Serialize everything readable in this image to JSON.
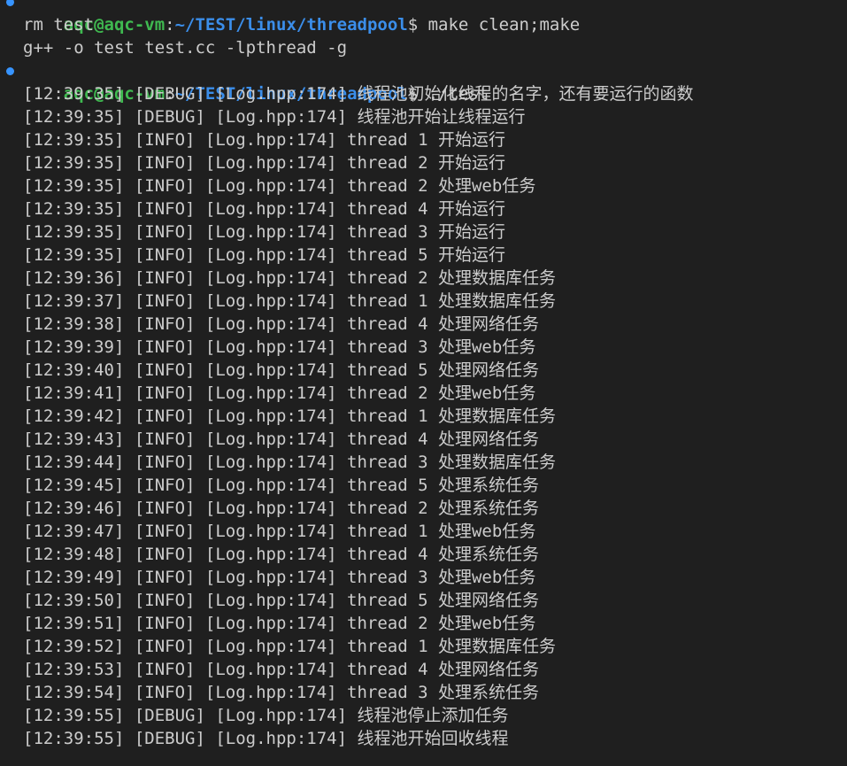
{
  "prompts": [
    {
      "user": "aqc@aqc-vm",
      "colon": ":",
      "path": "~/TEST/linux/threadpool",
      "dollar": "$ ",
      "command": "make clean;make"
    },
    {
      "user": "aqc@aqc-vm",
      "colon": ":",
      "path": "~/TEST/linux/threadpool",
      "dollar": "$ ",
      "command": "./test"
    }
  ],
  "build_output": [
    "rm test",
    "g++ -o test test.cc -lpthread -g"
  ],
  "log_lines": [
    "[12:39:35] [DEBUG] [Log.hpp:174] 线程池初始化线程的名字，还有要运行的函数",
    "[12:39:35] [DEBUG] [Log.hpp:174] 线程池开始让线程运行",
    "[12:39:35] [INFO] [Log.hpp:174] thread 1 开始运行",
    "[12:39:35] [INFO] [Log.hpp:174] thread 2 开始运行",
    "[12:39:35] [INFO] [Log.hpp:174] thread 2 处理web任务",
    "[12:39:35] [INFO] [Log.hpp:174] thread 4 开始运行",
    "[12:39:35] [INFO] [Log.hpp:174] thread 3 开始运行",
    "[12:39:35] [INFO] [Log.hpp:174] thread 5 开始运行",
    "[12:39:36] [INFO] [Log.hpp:174] thread 2 处理数据库任务",
    "[12:39:37] [INFO] [Log.hpp:174] thread 1 处理数据库任务",
    "[12:39:38] [INFO] [Log.hpp:174] thread 4 处理网络任务",
    "[12:39:39] [INFO] [Log.hpp:174] thread 3 处理web任务",
    "[12:39:40] [INFO] [Log.hpp:174] thread 5 处理网络任务",
    "[12:39:41] [INFO] [Log.hpp:174] thread 2 处理web任务",
    "[12:39:42] [INFO] [Log.hpp:174] thread 1 处理数据库任务",
    "[12:39:43] [INFO] [Log.hpp:174] thread 4 处理网络任务",
    "[12:39:44] [INFO] [Log.hpp:174] thread 3 处理数据库任务",
    "[12:39:45] [INFO] [Log.hpp:174] thread 5 处理系统任务",
    "[12:39:46] [INFO] [Log.hpp:174] thread 2 处理系统任务",
    "[12:39:47] [INFO] [Log.hpp:174] thread 1 处理web任务",
    "[12:39:48] [INFO] [Log.hpp:174] thread 4 处理系统任务",
    "[12:39:49] [INFO] [Log.hpp:174] thread 3 处理web任务",
    "[12:39:50] [INFO] [Log.hpp:174] thread 5 处理网络任务",
    "[12:39:51] [INFO] [Log.hpp:174] thread 2 处理web任务",
    "[12:39:52] [INFO] [Log.hpp:174] thread 1 处理数据库任务",
    "[12:39:53] [INFO] [Log.hpp:174] thread 4 处理网络任务",
    "[12:39:54] [INFO] [Log.hpp:174] thread 3 处理系统任务",
    "[12:39:55] [DEBUG] [Log.hpp:174] 线程池停止添加任务",
    "[12:39:55] [DEBUG] [Log.hpp:174] 线程池开始回收线程"
  ],
  "colors": {
    "background": "#1f1f1f",
    "text": "#cccccc",
    "user": "#3fb950",
    "path": "#3b8eea",
    "marker": "#3794ff"
  },
  "icons": {
    "prompt_marker": "command-decoration-dot-icon"
  }
}
